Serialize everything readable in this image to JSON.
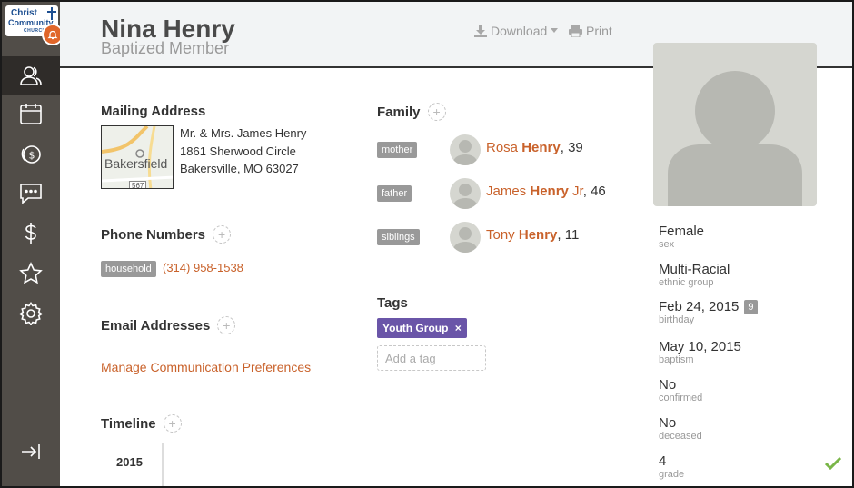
{
  "logo": {
    "line1": "Christ",
    "line2": "Community",
    "line3": "CHURCH"
  },
  "sidebar": {
    "items": [
      {
        "icon": "people-icon",
        "active": true
      },
      {
        "icon": "calendar-icon",
        "active": false
      },
      {
        "icon": "giving-icon",
        "active": false
      },
      {
        "icon": "message-icon",
        "active": false
      },
      {
        "icon": "dollar-icon",
        "active": false
      },
      {
        "icon": "star-icon",
        "active": false
      },
      {
        "icon": "gear-icon",
        "active": false
      }
    ],
    "logout_icon": "logout-icon"
  },
  "header": {
    "name": "Nina Henry",
    "role": "Baptized Member",
    "download_label": "Download",
    "print_label": "Print"
  },
  "mailing": {
    "title": "Mailing Address",
    "map_label": "Bakersfield",
    "map_road": "567",
    "addressee": "Mr. & Mrs. James Henry",
    "street": "1861 Sherwood Circle",
    "city": "Bakersville, MO 63027"
  },
  "phones": {
    "title": "Phone Numbers",
    "items": [
      {
        "type": "household",
        "number": "(314) 958-1538"
      }
    ]
  },
  "emails": {
    "title": "Email Addresses",
    "manage_link": "Manage Communication Preferences"
  },
  "timeline": {
    "title": "Timeline",
    "year": "2015"
  },
  "family": {
    "title": "Family",
    "members": [
      {
        "relation": "mother",
        "first": "Rosa",
        "last": "Henry",
        "suffix": "",
        "age": ", 39"
      },
      {
        "relation": "father",
        "first": "James",
        "last": "Henry",
        "suffix": " Jr",
        "age": ", 46"
      },
      {
        "relation": "siblings",
        "first": "Tony",
        "last": "Henry",
        "suffix": "",
        "age": ", 11"
      }
    ]
  },
  "tags": {
    "title": "Tags",
    "items": [
      {
        "label": "Youth Group",
        "remove": "×"
      }
    ],
    "placeholder": "Add a tag"
  },
  "facts": [
    {
      "value": "Female",
      "label": "sex"
    },
    {
      "value": "Multi-Racial",
      "label": "ethnic group"
    },
    {
      "value": "Feb 24, 2015",
      "label": "birthday",
      "badge": "9"
    },
    {
      "value": "May 10, 2015",
      "label": "baptism"
    },
    {
      "value": "No",
      "label": "confirmed"
    },
    {
      "value": "No",
      "label": "deceased"
    },
    {
      "value": "4",
      "label": "grade"
    }
  ],
  "colors": {
    "accent": "#c9622b",
    "sidebar": "#514d48",
    "tag": "#6a55a8",
    "check": "#7ab648"
  }
}
